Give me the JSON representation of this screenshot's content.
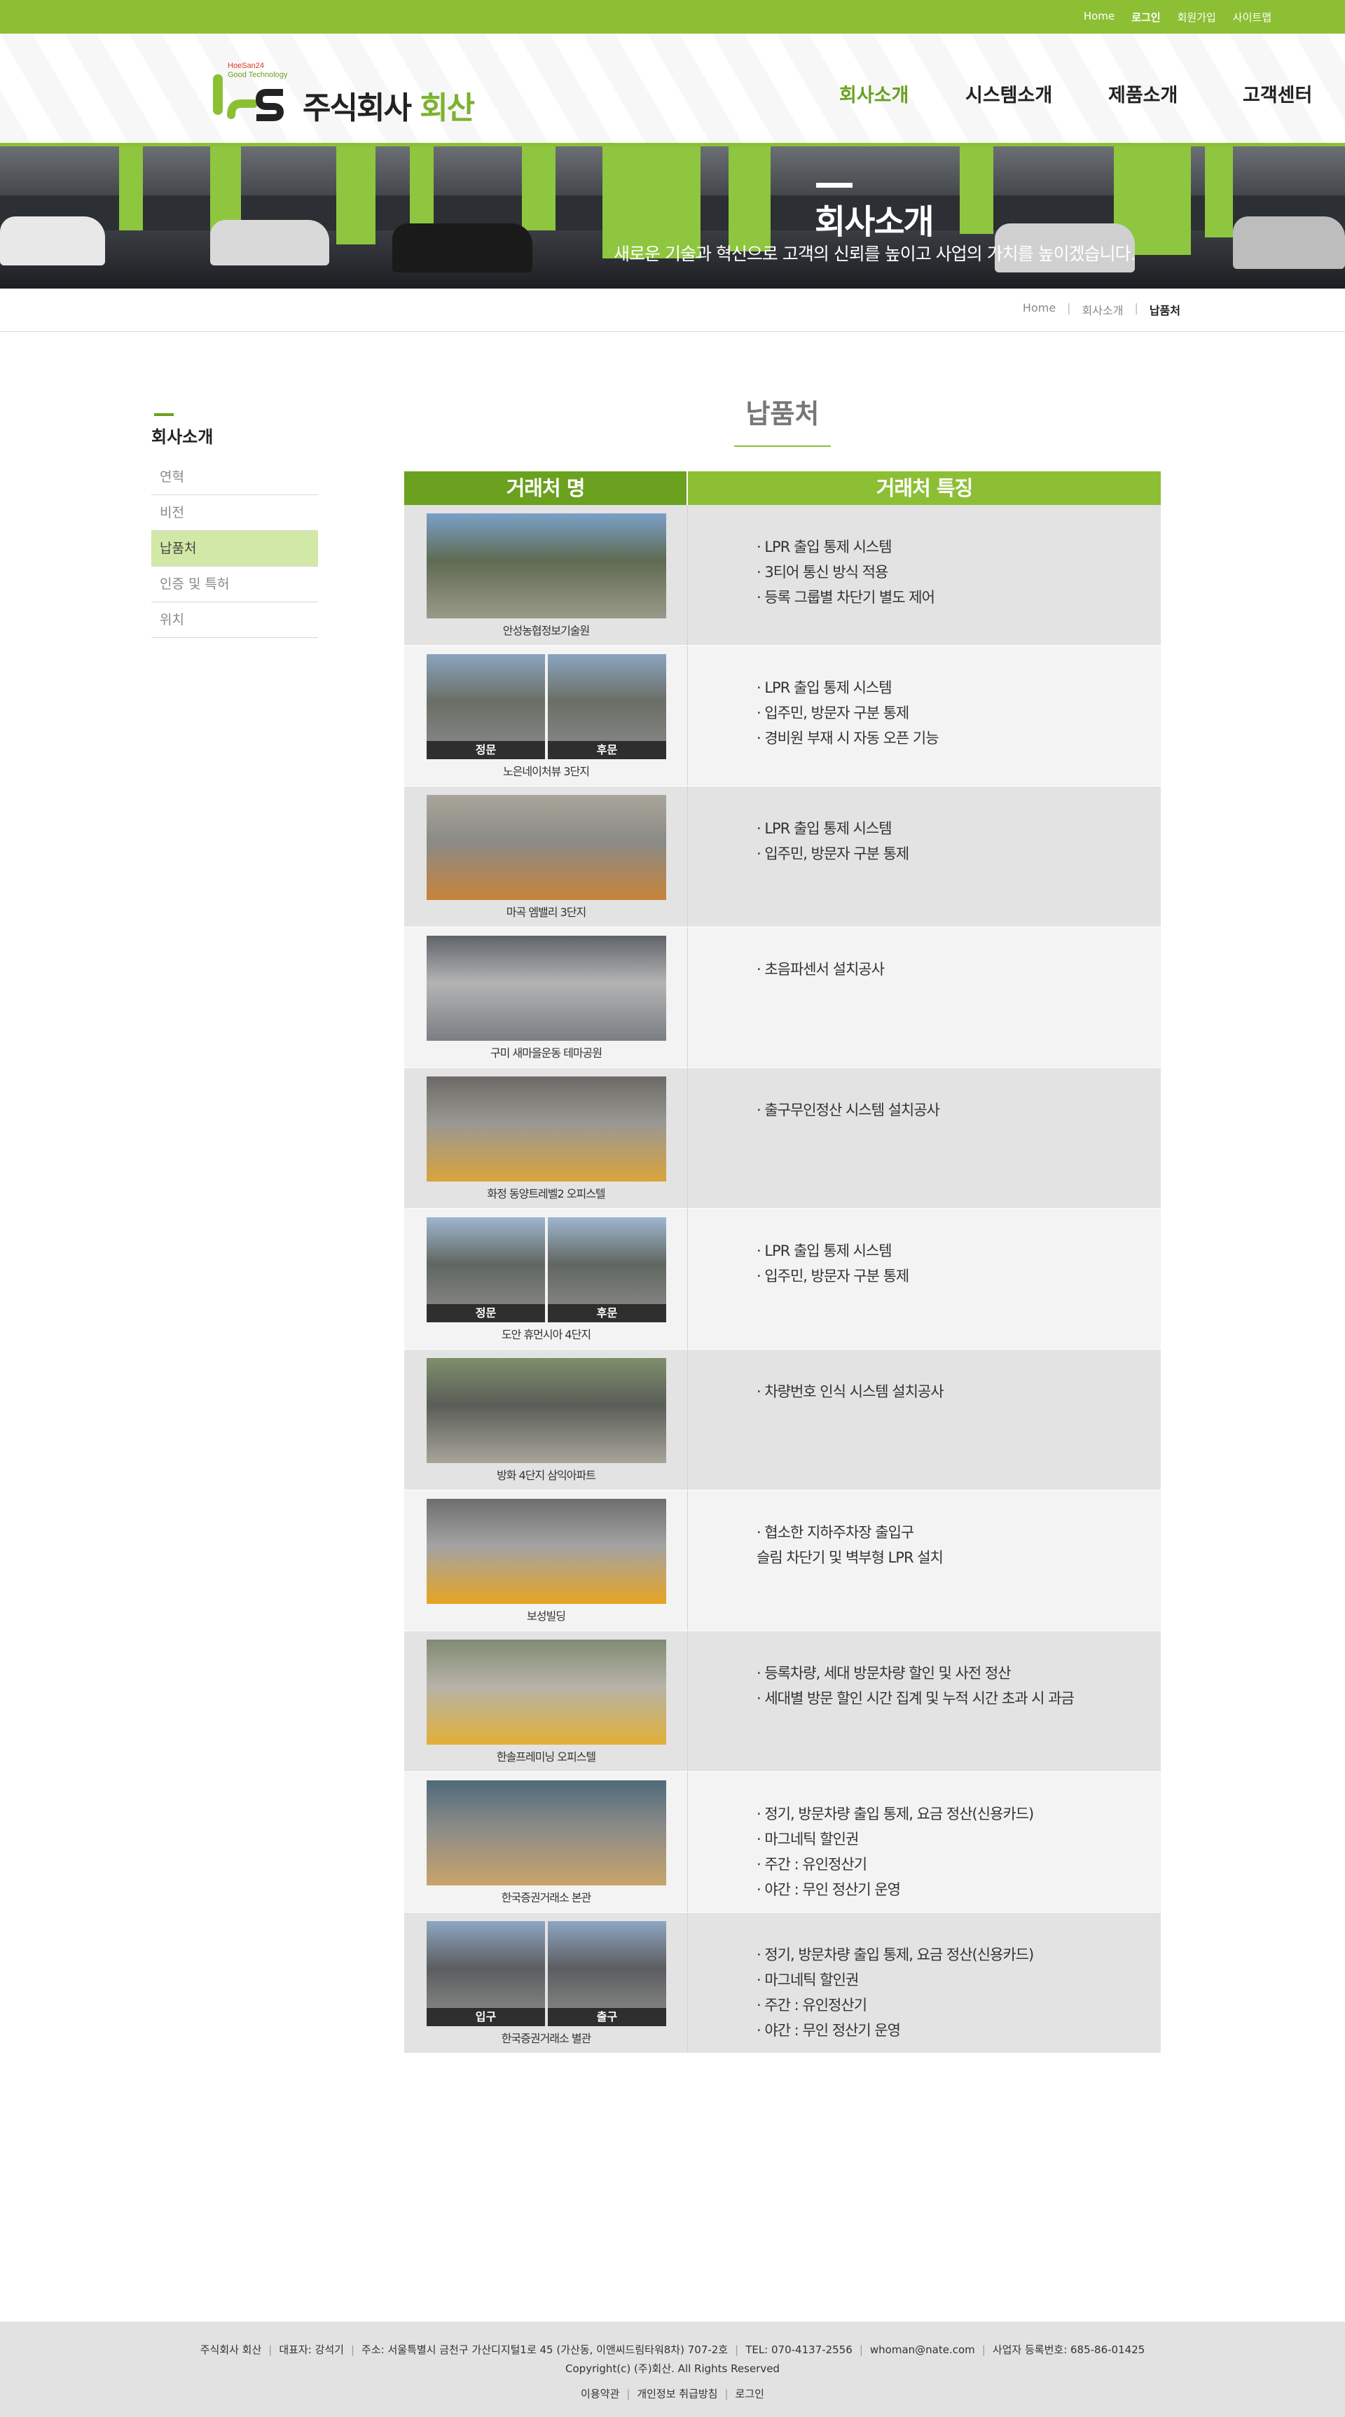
{
  "topbar": {
    "links": [
      "Home",
      "로그인",
      "회원가입",
      "사이트맵"
    ]
  },
  "logo": {
    "sub1": "HoeSan24",
    "sub2": "Good Technology",
    "name_main": "주식회사",
    "name_accent": "회산"
  },
  "nav": [
    "회사소개",
    "시스템소개",
    "제품소개",
    "고객센터"
  ],
  "banner": {
    "title": "회사소개",
    "subtitle": "새로운 기술과 혁신으로 고객의 신뢰를 높이고 사업의 가치를 높이겠습니다."
  },
  "breadcrumb": [
    "Home",
    "회사소개",
    "납품처"
  ],
  "sidebar": {
    "title": "회사소개",
    "items": [
      "연혁",
      "비전",
      "납품처",
      "인증 및 특허",
      "위치"
    ]
  },
  "content": {
    "title": "납품처",
    "col1": "거래처 명",
    "col2": "거래처 특징"
  },
  "clients": [
    {
      "name": "안성농협정보기술원",
      "features": [
        "· LPR 출입 통제 시스템",
        "· 3티어 통신 방식 적용",
        "· 등록 그룹별 차단기 별도 제어"
      ],
      "captions": []
    },
    {
      "name": "노은네이처뷰 3단지",
      "features": [
        "· LPR 출입 통제 시스템",
        "· 입주민, 방문자 구분 통제",
        "· 경비원 부재 시 자동 오픈 기능"
      ],
      "captions": [
        "정문",
        "후문"
      ]
    },
    {
      "name": "마곡 엠밸리 3단지",
      "features": [
        "· LPR 출입 통제 시스템",
        "· 입주민, 방문자 구분 통제"
      ],
      "captions": []
    },
    {
      "name": "구미 새마을운동 테마공원",
      "features": [
        "· 초음파센서 설치공사"
      ],
      "captions": []
    },
    {
      "name": "화정 동양트레벨2 오피스텔",
      "features": [
        "· 출구무인정산 시스템 설치공사"
      ],
      "captions": []
    },
    {
      "name": "도안 휴먼시아 4단지",
      "features": [
        "· LPR 출입 통제 시스템",
        "· 입주민, 방문자 구분 통제"
      ],
      "captions": [
        "정문",
        "후문"
      ]
    },
    {
      "name": "방화 4단지 삼익아파트",
      "features": [
        "· 차량번호 인식 시스템 설치공사"
      ],
      "captions": []
    },
    {
      "name": "보성빌딩",
      "features": [
        "· 협소한 지하주차장 출입구",
        "  슬림 차단기 및 벽부형 LPR 설치"
      ],
      "captions": []
    },
    {
      "name": "한솔프레미닝 오피스텔",
      "features": [
        "· 등록차량, 세대 방문차량 할인 및 사전 정산",
        "· 세대별 방문 할인 시간 집계 및 누적 시간 초과 시 과금"
      ],
      "captions": []
    },
    {
      "name": "한국증권거래소 본관",
      "features": [
        "· 정기, 방문차량 출입 통제, 요금 정산(신용카드)",
        "· 마그네틱 할인권",
        "· 주간 : 유인정산기",
        "· 야간 : 무인 정산기 운영"
      ],
      "captions": []
    },
    {
      "name": "한국증권거래소 별관",
      "features": [
        "· 정기, 방문차량 출입 통제, 요금 정산(신용카드)",
        "· 마그네틱 할인권",
        "· 주간 : 유인정산기",
        "· 야간 : 무인 정산기 운영"
      ],
      "captions": [
        "입구",
        "출구"
      ]
    }
  ],
  "footer": {
    "info": [
      "주식회사 회산",
      "대표자: 강석기",
      "주소: 서울특별시 금천구 가산디지털1로 45 (가산동, 이앤씨드림타워8차) 707-2호",
      "TEL: 070-4137-2556",
      "whoman@nate.com",
      "사업자 등록번호: 685-86-01425"
    ],
    "copyright": "Copyright(c) (주)회산. All Rights Reserved",
    "links": [
      "이용약관",
      "개인정보 취급방침",
      "로그인"
    ]
  }
}
